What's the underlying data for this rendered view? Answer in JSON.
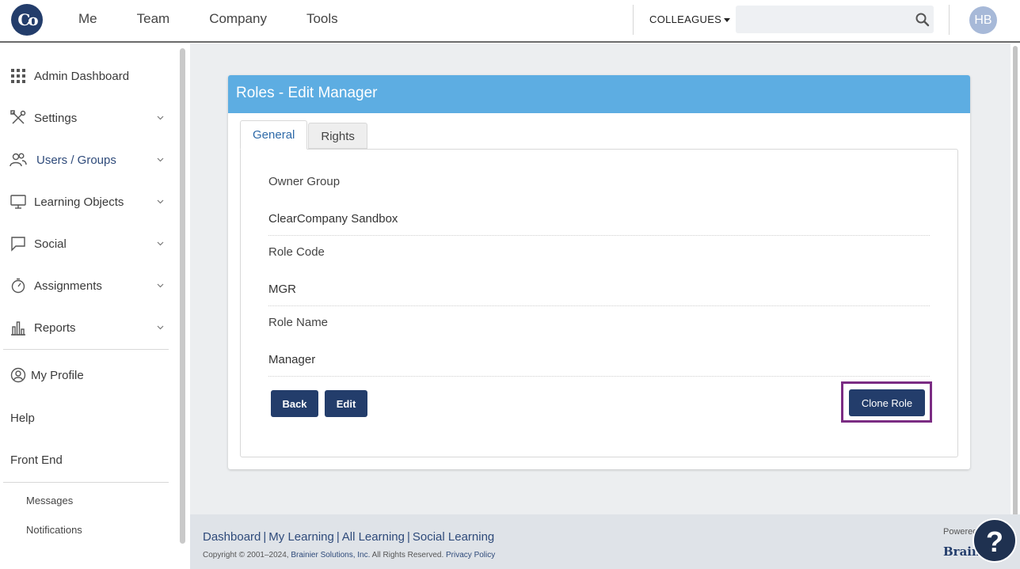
{
  "topbar": {
    "logo_text": "Co",
    "nav": [
      "Me",
      "Team",
      "Company",
      "Tools"
    ],
    "colleagues_label": "COLLEAGUES",
    "search_placeholder": "",
    "avatar_initials": "HB"
  },
  "sidebar": {
    "items": [
      {
        "label": "Admin Dashboard",
        "icon": "grid-icon"
      },
      {
        "label": "Settings",
        "icon": "tools-icon"
      },
      {
        "label": "Users / Groups",
        "icon": "users-icon"
      },
      {
        "label": "Learning Objects",
        "icon": "monitor-icon"
      },
      {
        "label": "Social",
        "icon": "chat-bubble-icon"
      },
      {
        "label": "Assignments",
        "icon": "stopwatch-icon"
      },
      {
        "label": "Reports",
        "icon": "bar-chart-icon"
      }
    ],
    "my_profile": "My Profile",
    "help": "Help",
    "front_end": "Front End",
    "messages": "Messages",
    "notifications": "Notifications"
  },
  "card": {
    "title": "Roles - Edit Manager",
    "tabs": [
      "General",
      "Rights"
    ],
    "fields": [
      {
        "label": "Owner Group",
        "value": "ClearCompany Sandbox"
      },
      {
        "label": "Role Code",
        "value": "MGR"
      },
      {
        "label": "Role Name",
        "value": "Manager"
      }
    ],
    "back_label": "Back",
    "edit_label": "Edit",
    "clone_label": "Clone Role"
  },
  "footer": {
    "links": [
      "Dashboard",
      "My Learning",
      "All Learning",
      "Social Learning"
    ],
    "copyright_prefix": "Copyright © 2001–2024, ",
    "company_link": "Brainier Solutions, Inc.",
    "rights_text": " All Rights Reserved. ",
    "privacy_link": "Privacy Policy",
    "powered_by": "Powered",
    "brand": "Brain"
  },
  "help_button_label": "?",
  "colors": {
    "header_blue": "#5dade2",
    "navy": "#233d6b",
    "highlight": "#7b2c83"
  }
}
